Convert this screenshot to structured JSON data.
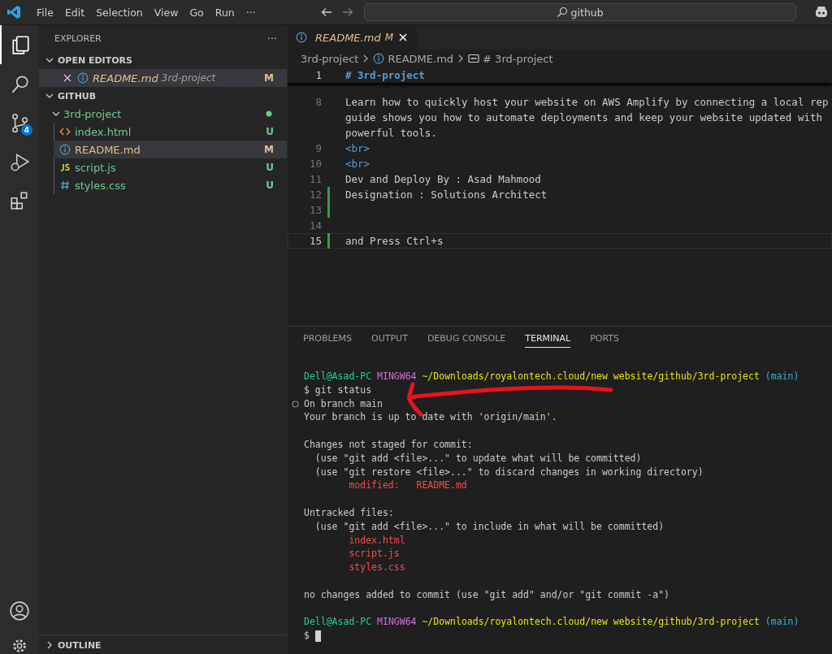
{
  "title_bar": {
    "menu": [
      "File",
      "Edit",
      "Selection",
      "View",
      "Go",
      "Run",
      "···"
    ],
    "search": {
      "value": "github"
    }
  },
  "activity_bar": {
    "items": [
      {
        "kind": "explorer",
        "selected": true
      },
      {
        "kind": "search",
        "selected": false
      },
      {
        "kind": "source-control",
        "selected": false,
        "badge": "4"
      },
      {
        "kind": "run-debug",
        "selected": false
      },
      {
        "kind": "extensions",
        "selected": false
      }
    ]
  },
  "sidebar": {
    "title": "EXPLORER",
    "more": "···",
    "open_editors": {
      "title": "OPEN EDITORS",
      "expanded": true,
      "items": [
        {
          "name": "README.md",
          "folder": "3rd-project",
          "status": "M",
          "color": "#e2c08d",
          "kind": "markdown",
          "selected": true
        }
      ]
    },
    "folder": {
      "title": "GITHUB",
      "expanded": true,
      "items": [
        {
          "name": "3rd-project",
          "expanded": true,
          "color": "#73c991",
          "children": [
            {
              "name": "index.html",
              "kind": "html",
              "status": "U",
              "color": "#73c991",
              "selected": false
            },
            {
              "name": "README.md",
              "kind": "markdown",
              "status": "M",
              "color": "#e2c08d",
              "selected": true
            },
            {
              "name": "script.js",
              "kind": "js",
              "status": "U",
              "color": "#73c991",
              "selected": false
            },
            {
              "name": "styles.css",
              "kind": "css",
              "status": "U",
              "color": "#73c991",
              "selected": false
            }
          ]
        }
      ]
    },
    "outline": {
      "title": "OUTLINE",
      "expanded": false
    }
  },
  "editor": {
    "tabs": [
      {
        "name": "README.md",
        "status": "M",
        "color": "#e2c08d",
        "selected": true
      }
    ],
    "breadcrumbs": [
      {
        "kind": "folder",
        "text": "3rd-project"
      },
      {
        "kind": "file",
        "text": "README.md"
      },
      {
        "kind": "symbol",
        "text": "# 3rd-project"
      }
    ],
    "sticky_line": {
      "number": "1",
      "kind": "heading",
      "text": [
        "# 3rd-project"
      ]
    },
    "lines": [
      {
        "number": "8",
        "kind": "plain",
        "text": [
          "Learn how to quickly host your website on AWS Amplify by connecting a local rep",
          "guide shows you how to automate deployments and keep your website updated with",
          "powerful tools."
        ],
        "changed": false,
        "current": false
      },
      {
        "number": "9",
        "kind": "tag",
        "text": [
          "<br>"
        ],
        "changed": false,
        "current": false
      },
      {
        "number": "10",
        "kind": "tag",
        "text": [
          "<br>"
        ],
        "changed": false,
        "current": false
      },
      {
        "number": "11",
        "kind": "plain",
        "text": [
          "Dev and Deploy By : Asad Mahmood"
        ],
        "changed": false,
        "current": false
      },
      {
        "number": "12",
        "kind": "plain",
        "text": [
          "Designation : Solutions Architect"
        ],
        "changed": true,
        "current": false
      },
      {
        "number": "13",
        "changed": true,
        "current": false
      },
      {
        "number": "14",
        "changed": false,
        "current": false
      },
      {
        "number": "15",
        "kind": "plain",
        "text": [
          "and Press Ctrl+s"
        ],
        "changed": true,
        "current": true
      }
    ]
  },
  "panel": {
    "tabs": [
      {
        "label": "PROBLEMS",
        "selected": false
      },
      {
        "label": "OUTPUT",
        "selected": false
      },
      {
        "label": "DEBUG CONSOLE",
        "selected": false
      },
      {
        "label": "TERMINAL",
        "selected": true
      },
      {
        "label": "PORTS",
        "selected": false
      }
    ],
    "terminal": [
      {
        "kind": "prompt",
        "user": "Dell@Asad-PC",
        "shell": "MINGW64",
        "path": "~/Downloads/royalontech.cloud/new website/github/3rd-project",
        "branch": "(main)"
      },
      {
        "kind": "command",
        "text": "$ git status"
      },
      {
        "kind": "marked",
        "text": "On branch main"
      },
      {
        "kind": "output",
        "text": "Your branch is up to date with 'origin/main'."
      },
      {
        "kind": "blank"
      },
      {
        "kind": "output",
        "text": "Changes not staged for commit:"
      },
      {
        "kind": "output",
        "text": "  (use \"git add <file>...\" to update what will be committed)"
      },
      {
        "kind": "output",
        "text": "  (use \"git restore <file>...\" to discard changes in working directory)"
      },
      {
        "kind": "file",
        "text": "        modified:   README.md"
      },
      {
        "kind": "blank"
      },
      {
        "kind": "output",
        "text": "Untracked files:"
      },
      {
        "kind": "output",
        "text": "  (use \"git add <file>...\" to include in what will be committed)"
      },
      {
        "kind": "file",
        "text": "        index.html"
      },
      {
        "kind": "file",
        "text": "        script.js"
      },
      {
        "kind": "file",
        "text": "        styles.css"
      },
      {
        "kind": "blank"
      },
      {
        "kind": "output",
        "text": "no changes added to commit (use \"git add\" and/or \"git commit -a\")"
      },
      {
        "kind": "blank"
      },
      {
        "kind": "prompt",
        "user": "Dell@Asad-PC",
        "shell": "MINGW64",
        "path": "~/Downloads/royalontech.cloud/new website/github/3rd-project",
        "branch": "(main)"
      },
      {
        "kind": "input",
        "text": "$"
      }
    ]
  }
}
